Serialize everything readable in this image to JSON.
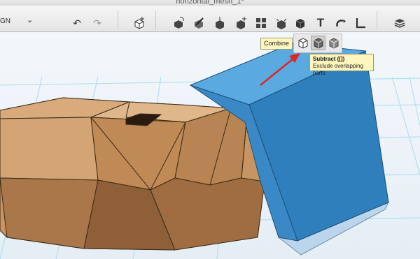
{
  "window": {
    "title": "horizontal_mesh_1*"
  },
  "toolbar": {
    "design_menu": "GN",
    "buttons": [
      {
        "name": "undo-icon"
      },
      {
        "name": "redo-icon"
      },
      {
        "name": "add-primitive-icon"
      },
      {
        "name": "transform-icon"
      },
      {
        "name": "sketch-icon"
      },
      {
        "name": "construct-icon"
      },
      {
        "name": "modify-icon"
      },
      {
        "name": "pattern-icon"
      },
      {
        "name": "grouping-icon"
      },
      {
        "name": "combine-icon"
      },
      {
        "name": "text-icon"
      },
      {
        "name": "snap-icon"
      },
      {
        "name": "measure-icon"
      },
      {
        "name": "material-icon"
      }
    ],
    "text_button": "T"
  },
  "flyout": {
    "tooltip": "Combine",
    "buttons": [
      "merge-icon",
      "subtract-icon",
      "intersect-icon"
    ],
    "active": "subtract-icon"
  },
  "tooltip": {
    "title": "Subtract ([])",
    "description": "Exclude overlapping parts"
  },
  "colors": {
    "blue_box": "#2e83c4",
    "wood": "#c79563",
    "grid": "#9fd6ea",
    "arrow": "#e02424"
  }
}
